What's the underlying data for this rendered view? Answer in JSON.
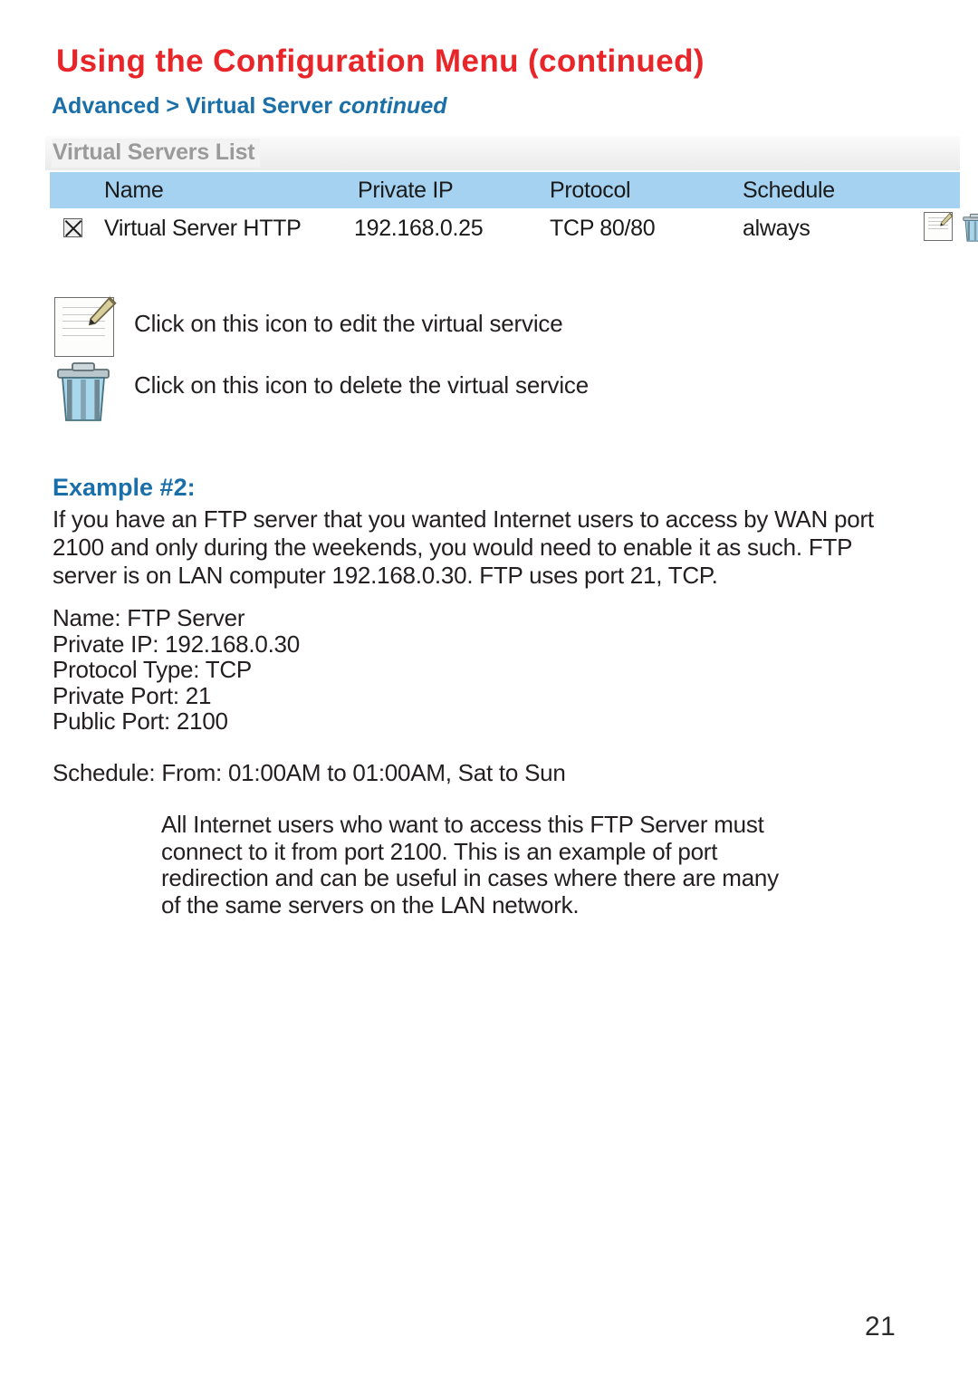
{
  "page": {
    "title": "Using the Configuration Menu (continued)",
    "breadcrumb_main": "Advanced > Virtual Server ",
    "breadcrumb_italic": "continued",
    "page_number": "21",
    "title_color": "#e8262a",
    "accent_color": "#1a6fa8",
    "table_header_color": "#a5d2f0"
  },
  "panel": {
    "title": "Virtual Servers List",
    "columns": {
      "name": "Name",
      "private_ip": "Private IP",
      "protocol": "Protocol",
      "schedule": "Schedule"
    },
    "rows": [
      {
        "enabled": true,
        "name": "Virtual Server HTTP",
        "private_ip": "192.168.0.25",
        "protocol": "TCP 80/80",
        "schedule": "always"
      }
    ]
  },
  "instructions": [
    {
      "icon": "edit-icon",
      "text": "Click on this icon to edit the virtual service"
    },
    {
      "icon": "trash-icon",
      "text": "Click on this icon to delete the virtual service"
    }
  ],
  "example": {
    "heading": "Example #2:",
    "intro": "If you have an FTP server that you wanted Internet users to access by WAN port 2100 and only during the weekends, you would need to enable it as such. FTP server is on LAN computer 192.168.0.30. FTP uses port 21, TCP.",
    "specs": "Name: FTP Server\nPrivate IP: 192.168.0.30\nProtocol Type: TCP\nPrivate Port: 21\nPublic Port: 2100",
    "schedule": "Schedule: From: 01:00AM to 01:00AM, Sat to Sun",
    "note": "All Internet users who want to access this FTP Server must connect to it from port 2100. This is an example of port redirection and can be useful in cases where there are many of the same servers on the LAN network."
  }
}
